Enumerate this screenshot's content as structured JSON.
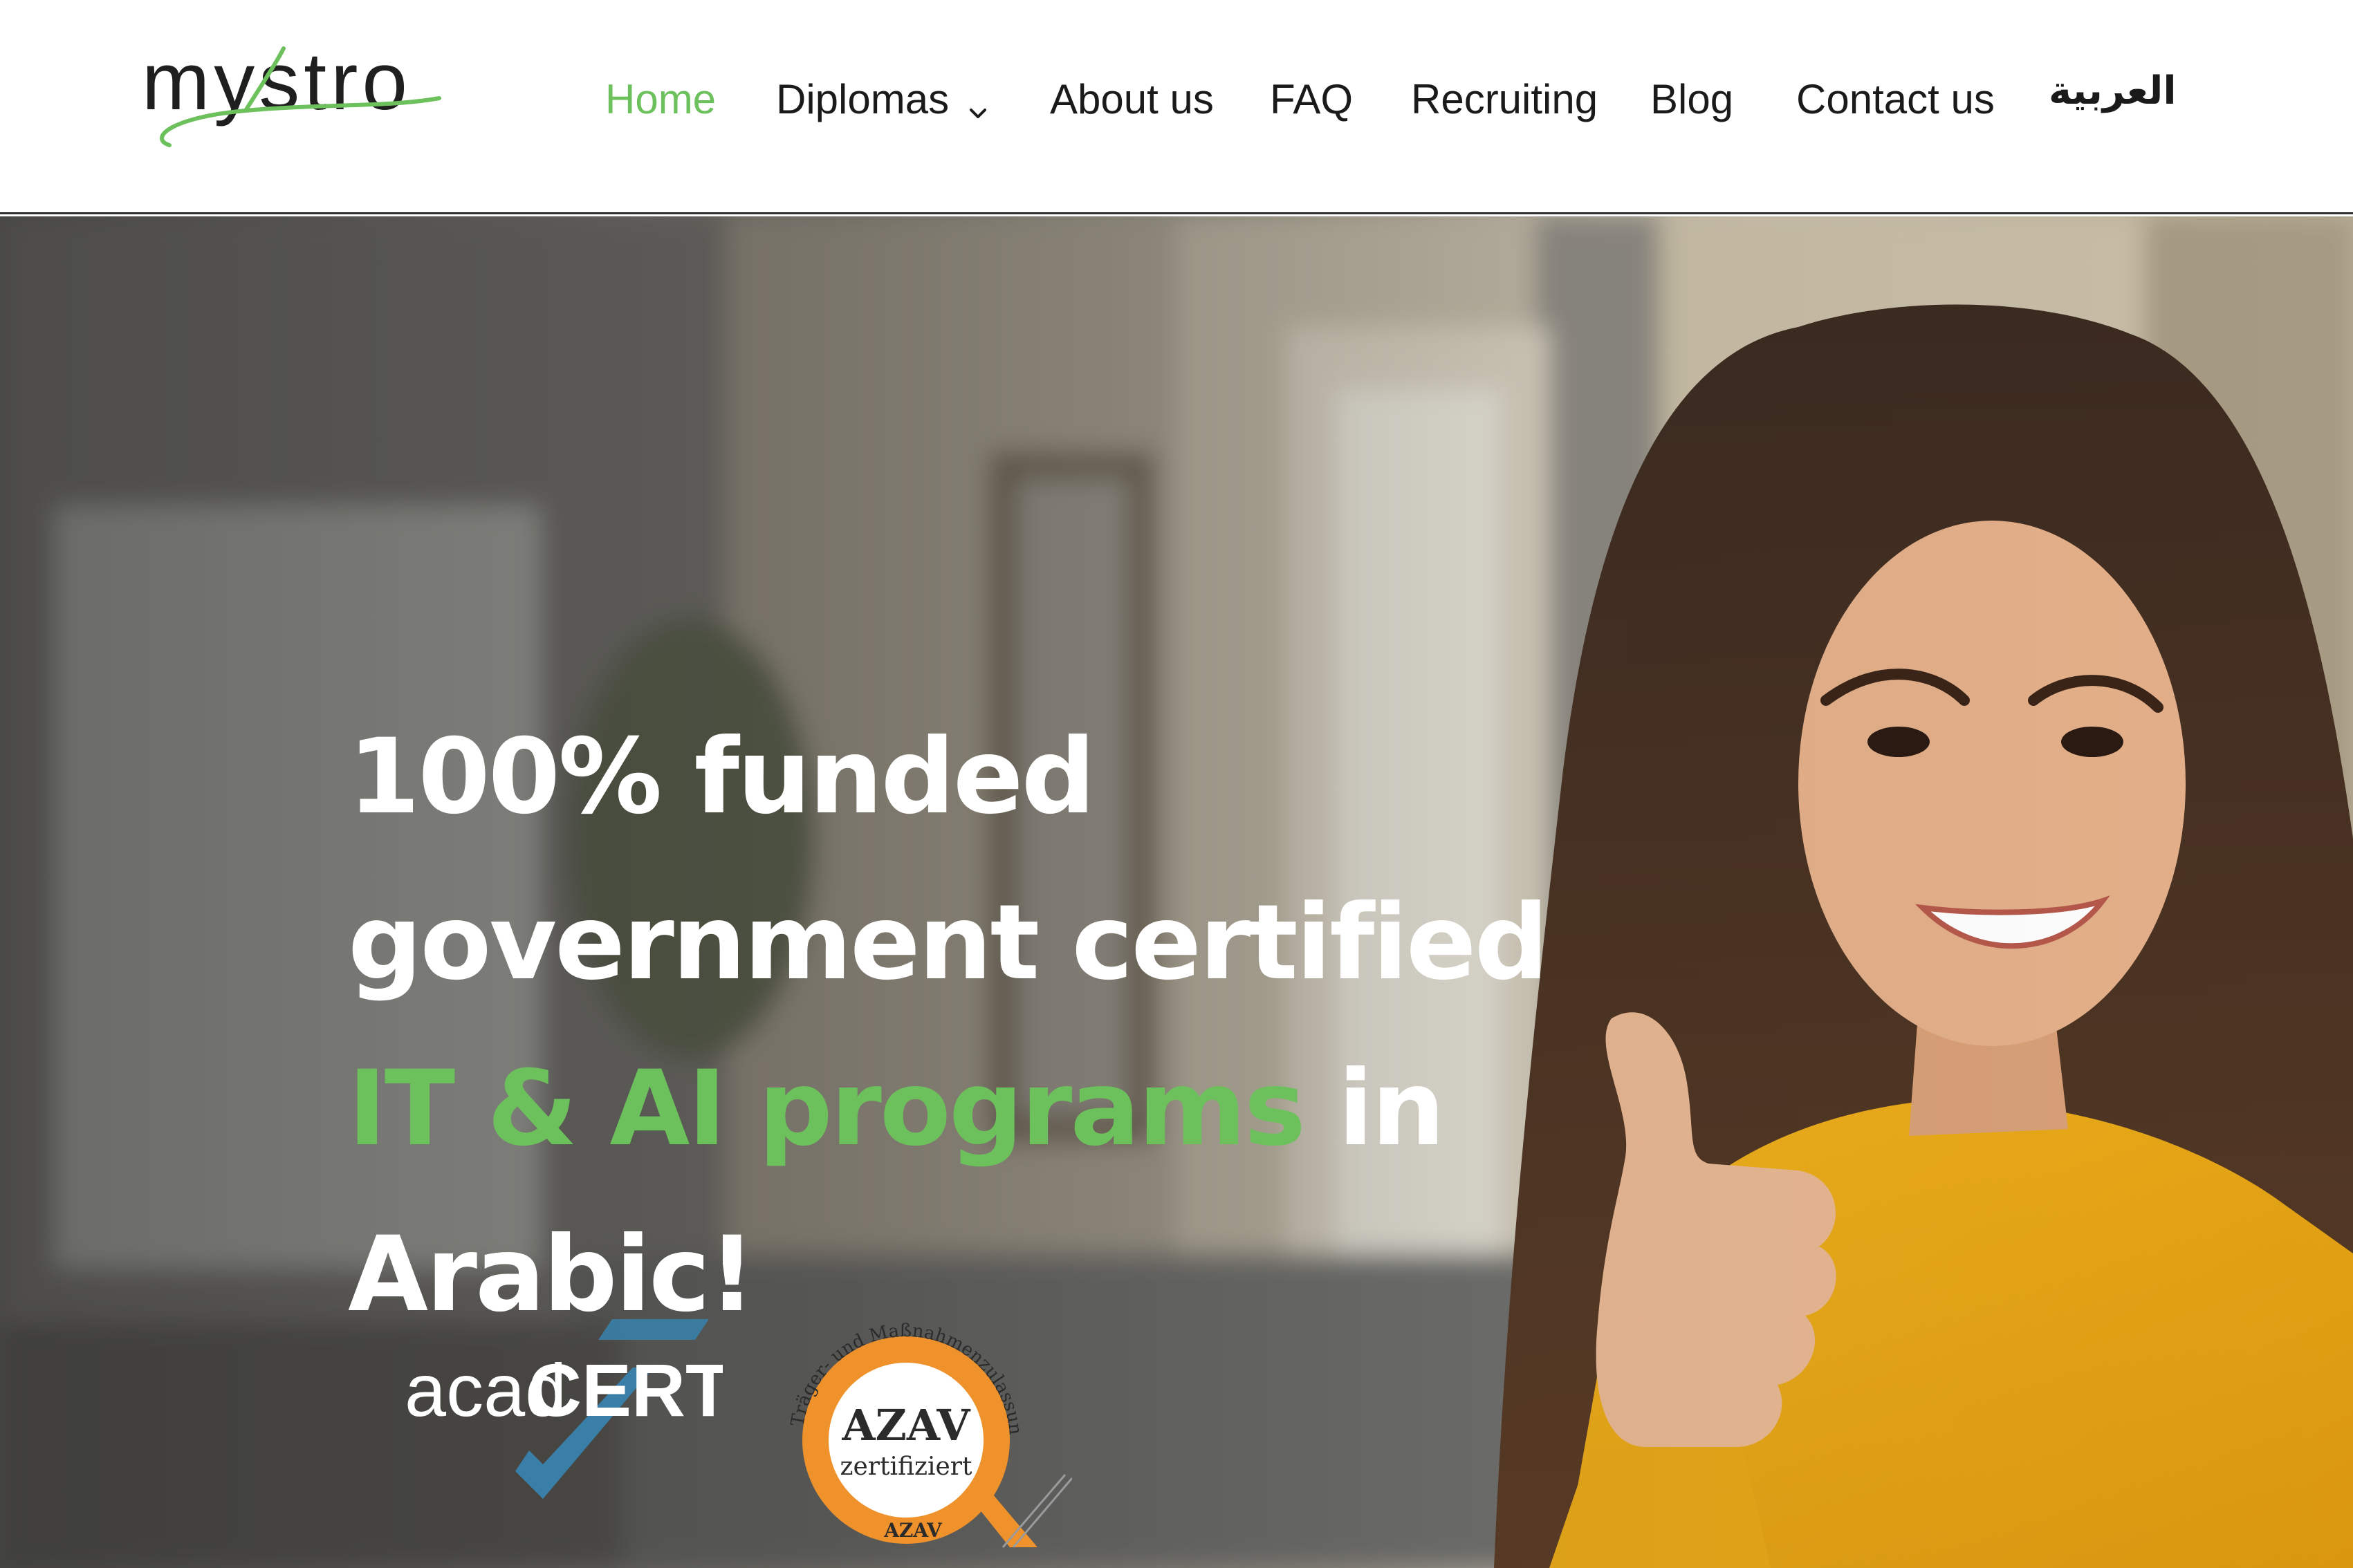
{
  "header": {
    "logo_text": "mystro",
    "nav": {
      "home": "Home",
      "diplomas": "Diplomas",
      "about": "About us",
      "faq": "FAQ",
      "recruiting": "Recruiting",
      "blog": "Blog",
      "contact": "Contact us",
      "arabic": "العربية"
    },
    "active_item": "Home"
  },
  "hero": {
    "headline": {
      "line1": "100% funded",
      "line2": "government certified",
      "line3_highlight": "IT & AI programs",
      "line3_rest": " in",
      "line4": "Arabic!"
    },
    "badges": {
      "acad": {
        "prefix": "acad",
        "suffix": "CERT"
      },
      "azav": {
        "ring_text": "Träger- und Maßnahmenzulassung",
        "title": "AZAV",
        "subtitle": "zertifiziert",
        "bottom": "AZAV"
      }
    }
  },
  "colors": {
    "accent_green": "#6cc15c",
    "text_dark": "#1a1a1a",
    "hero_text": "#ffffff",
    "azav_orange": "#f0922b",
    "acad_blue": "#3a7fa8",
    "sweater_yellow": "#e8a514"
  },
  "icons": {
    "diplomas_dropdown": "chevron-down-icon"
  }
}
